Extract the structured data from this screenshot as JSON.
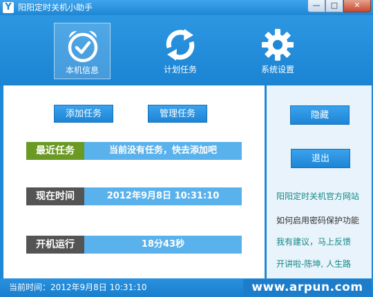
{
  "window": {
    "title": "阳阳定时关机小助手",
    "app_icon_letter": "Y",
    "minimize_symbol": "—",
    "maximize_symbol": "□",
    "close_symbol": "✕"
  },
  "nav": {
    "items": [
      {
        "label": "本机信息",
        "icon": "alarm-clock-icon",
        "active": true
      },
      {
        "label": "计划任务",
        "icon": "refresh-arrows-icon",
        "active": false
      },
      {
        "label": "系统设置",
        "icon": "gear-icon",
        "active": false
      }
    ]
  },
  "actions": {
    "add_task": "添加任务",
    "manage_tasks": "管理任务"
  },
  "info": {
    "recent_task_label": "最近任务",
    "recent_task_value": "当前没有任务，快去添加吧",
    "current_time_label": "现在时间",
    "current_time_value": "2012年9月8日  10:31:10",
    "uptime_label": "开机运行",
    "uptime_value": "18分43秒"
  },
  "side": {
    "hide_button": "隐藏",
    "exit_button": "退出",
    "links": [
      {
        "text": "阳阳定时关机官方网站",
        "color": "#138a86"
      },
      {
        "text": "如何启用密码保护功能",
        "color": "#333333"
      },
      {
        "text": "我有建议，马上反馈",
        "color": "#138a86"
      },
      {
        "text": "开讲啦-陈坤, 人生路",
        "color": "#138a86"
      }
    ]
  },
  "status": {
    "text": "当前时间：2012年9月8日  10:31:10",
    "watermark": "www.arpun.com"
  },
  "colors": {
    "accent": "#1f88d6",
    "green_label": "#6a9a24",
    "gray_label": "#545454",
    "row_bg": "#5ab2ec"
  }
}
